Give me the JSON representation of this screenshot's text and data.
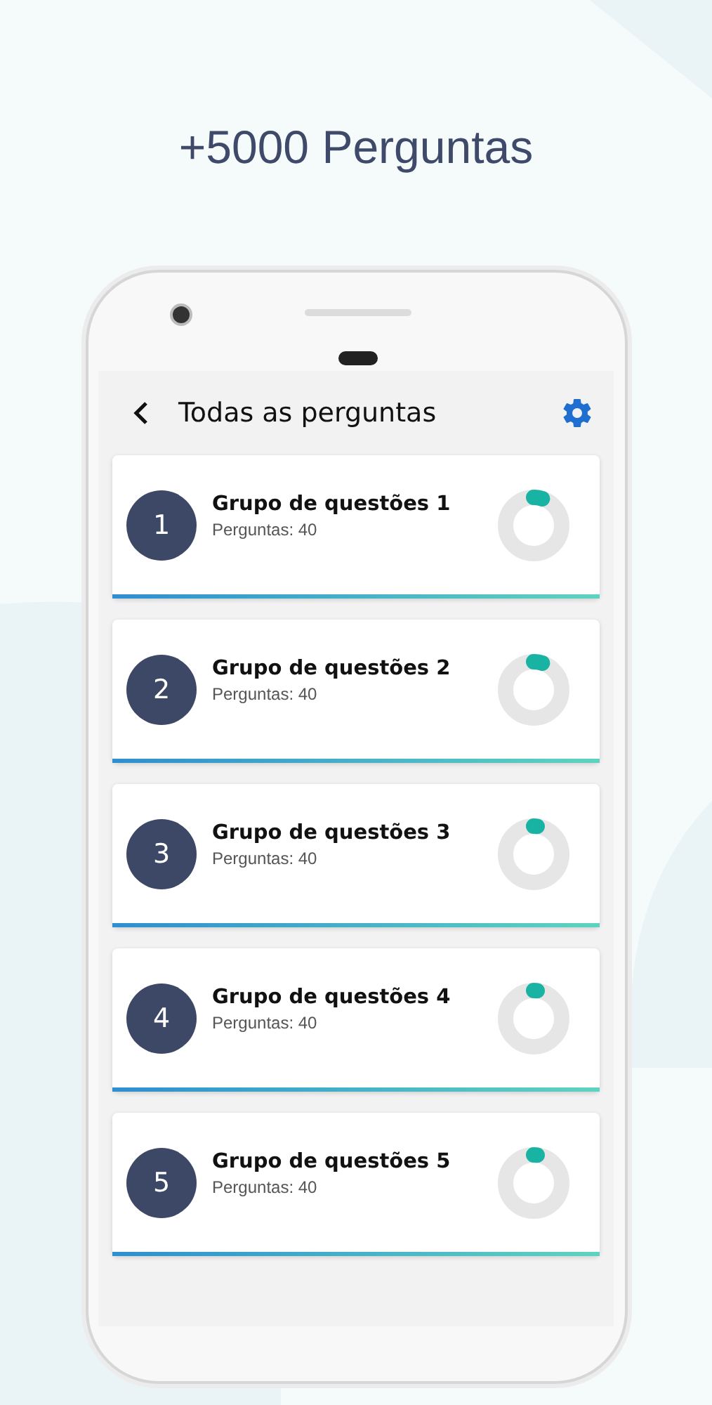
{
  "headline": "+5000 Perguntas",
  "screen": {
    "title": "Todas as perguntas",
    "groups": [
      {
        "number": "1",
        "title": "Grupo de questões 1",
        "subtitle": "Perguntas: 40",
        "level": 0.05
      },
      {
        "number": "2",
        "title": "Grupo de questões 2",
        "subtitle": "Perguntas: 40",
        "level": 0.05
      },
      {
        "number": "3",
        "title": "Grupo de questões 3",
        "subtitle": "Perguntas: 40",
        "level": 0.02
      },
      {
        "number": "4",
        "title": "Grupo de questões 4",
        "subtitle": "Perguntas: 40",
        "level": 0.02
      },
      {
        "number": "5",
        "title": "Grupo de questões 5",
        "subtitle": "Perguntas: 40",
        "level": 0.02
      }
    ]
  }
}
